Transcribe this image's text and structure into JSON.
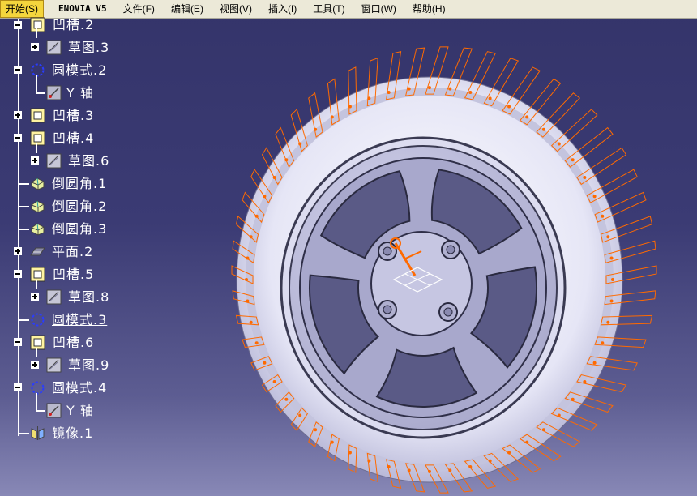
{
  "menubar": {
    "items": [
      "开始(S)",
      "ENOVIA V5",
      "文件(F)",
      "编辑(E)",
      "视图(V)",
      "插入(I)",
      "工具(T)",
      "窗口(W)",
      "帮助(H)"
    ]
  },
  "tree": {
    "nodes": [
      {
        "label": "凹槽.2",
        "icon": "pocket-icon"
      },
      {
        "label": "草图.3",
        "icon": "sketch-icon"
      },
      {
        "label": "圆模式.2",
        "icon": "circular-pattern-icon"
      },
      {
        "label": "Y 轴",
        "icon": "axis-icon"
      },
      {
        "label": "凹槽.3",
        "icon": "pocket-icon"
      },
      {
        "label": "凹槽.4",
        "icon": "pocket-icon"
      },
      {
        "label": "草图.6",
        "icon": "sketch-icon"
      },
      {
        "label": "倒圆角.1",
        "icon": "fillet-icon"
      },
      {
        "label": "倒圆角.2",
        "icon": "fillet-icon"
      },
      {
        "label": "倒圆角.3",
        "icon": "fillet-icon"
      },
      {
        "label": "平面.2",
        "icon": "plane-icon"
      },
      {
        "label": "凹槽.5",
        "icon": "pocket-icon"
      },
      {
        "label": "草图.8",
        "icon": "sketch-icon"
      },
      {
        "label": "圆模式.3",
        "icon": "circular-pattern-icon"
      },
      {
        "label": "凹槽.6",
        "icon": "pocket-icon"
      },
      {
        "label": "草图.9",
        "icon": "sketch-icon"
      },
      {
        "label": "圆模式.4",
        "icon": "circular-pattern-icon"
      },
      {
        "label": "Y 轴",
        "icon": "axis-icon"
      },
      {
        "label": "镜像.1",
        "icon": "mirror-icon"
      }
    ]
  },
  "colors": {
    "background_top": "#34346a",
    "background_bottom": "#8888b6",
    "part_fill": "#d8d8ee",
    "highlight": "#ff6a00",
    "tree_text": "#ffffff"
  }
}
